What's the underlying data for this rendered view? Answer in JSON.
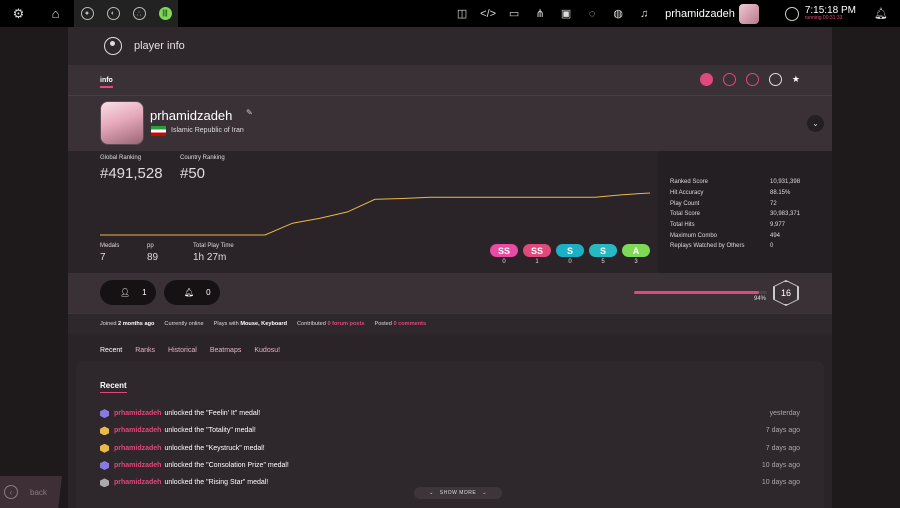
{
  "topbar": {
    "settings_icon": "gear-icon",
    "home_icon": "home-icon",
    "rulesets": [
      "osu",
      "taiko",
      "catch",
      "mania"
    ],
    "toolbar_icons": [
      "discord-icon",
      "code-icon",
      "tablet-icon",
      "hierarchy-icon",
      "beatmap-icon",
      "chat-icon",
      "globe-icon",
      "music-icon"
    ],
    "username": "prhamidzadeh",
    "clock_time": "7:15:18 PM",
    "clock_sub": "running 00:31:33"
  },
  "overlay": {
    "title": "player info",
    "tab": "info"
  },
  "user": {
    "username": "prhamidzadeh",
    "country": "Islamic Republic of Iran"
  },
  "stats": {
    "global_label": "Global Ranking",
    "global_value": "#491,528",
    "country_label": "Country Ranking",
    "country_value": "#50",
    "medals_label": "Medals",
    "medals_value": "7",
    "pp_label": "pp",
    "pp_value": "89",
    "playtime_label": "Total Play Time",
    "playtime_value": "1h 27m",
    "grades": [
      {
        "label": "SS",
        "count": "0",
        "color": "#e94aa4"
      },
      {
        "label": "SS",
        "count": "1",
        "color": "#e0497b"
      },
      {
        "label": "S",
        "count": "0",
        "color": "#1bb0c4"
      },
      {
        "label": "S",
        "count": "5",
        "color": "#28b8c4"
      },
      {
        "label": "A",
        "count": "3",
        "color": "#7ed957"
      }
    ],
    "side": [
      {
        "label": "Ranked Score",
        "value": "10,931,398"
      },
      {
        "label": "Hit Accuracy",
        "value": "88.15%"
      },
      {
        "label": "Play Count",
        "value": "72"
      },
      {
        "label": "Total Score",
        "value": "30,983,371"
      },
      {
        "label": "Total Hits",
        "value": "9,977"
      },
      {
        "label": "Maximum Combo",
        "value": "494"
      },
      {
        "label": "Replays Watched by Others",
        "value": "0"
      }
    ]
  },
  "chart_data": {
    "type": "line",
    "x": [
      0,
      1,
      2,
      3,
      4,
      5,
      6,
      7,
      8,
      9,
      10,
      11,
      12,
      13,
      14,
      15,
      16,
      17,
      18,
      19,
      20
    ],
    "values": [
      0,
      0,
      0,
      0,
      0,
      0,
      0,
      0.28,
      0.4,
      0.55,
      0.85,
      0.87,
      0.9,
      0.9,
      0.9,
      0.9,
      0.9,
      0.9,
      0.9,
      0.96,
      1.0
    ],
    "title": "",
    "xlabel": "",
    "ylabel": ""
  },
  "social": {
    "followers": "1",
    "mapping_subscribers": "0",
    "level_progress": 0.94,
    "level_pct": "94%",
    "level": "16"
  },
  "info_line": {
    "joined_prefix": "Joined",
    "joined_value": "2 months ago",
    "online": "Currently online",
    "plays_prefix": "Plays with",
    "plays_value": "Mouse, Keyboard",
    "contributed_prefix": "Contributed",
    "contributed_value": "0 forum posts",
    "posted_prefix": "Posted",
    "posted_value": "0 comments"
  },
  "subnav": [
    "Recent",
    "Ranks",
    "Historical",
    "Beatmaps",
    "Kudosu!"
  ],
  "recent": {
    "title": "Recent",
    "events": [
      {
        "user": "prhamidzadeh",
        "text": "unlocked the \"Feelin' It\" medal!",
        "time": "yesterday",
        "medal_color": "#8a7ae0"
      },
      {
        "user": "prhamidzadeh",
        "text": "unlocked the \"Totality\" medal!",
        "time": "7 days ago",
        "medal_color": "#e8b84a"
      },
      {
        "user": "prhamidzadeh",
        "text": "unlocked the \"Keystruck\" medal!",
        "time": "7 days ago",
        "medal_color": "#e8b84a"
      },
      {
        "user": "prhamidzadeh",
        "text": "unlocked the \"Consolation Prize\" medal!",
        "time": "10 days ago",
        "medal_color": "#8a7ae0"
      },
      {
        "user": "prhamidzadeh",
        "text": "unlocked the \"Rising Star\" medal!",
        "time": "10 days ago",
        "medal_color": "#aaaaaa"
      }
    ],
    "show_more": "SHOW MORE"
  },
  "back_label": "back"
}
